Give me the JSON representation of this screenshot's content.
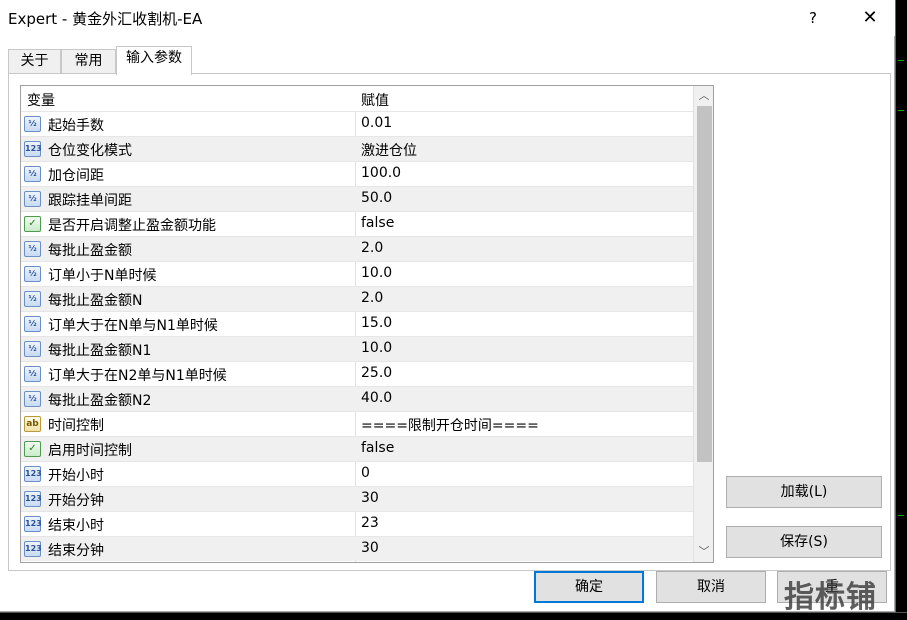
{
  "window": {
    "title": "Expert - 黄金外汇收割机-EA",
    "help_label": "?",
    "close_label": "✕"
  },
  "tabs": [
    {
      "label": "关于"
    },
    {
      "label": "常用"
    },
    {
      "label": "输入参数"
    }
  ],
  "active_tab": "输入参数",
  "grid": {
    "headers": {
      "variable": "变量",
      "value": "赋值"
    },
    "rows": [
      {
        "icon": "double-type-icon",
        "icon_glyph": "½",
        "name": "起始手数",
        "value": "0.01"
      },
      {
        "icon": "int-type-icon",
        "icon_glyph": "123",
        "name": "仓位变化模式",
        "value": "激进仓位"
      },
      {
        "icon": "double-type-icon",
        "icon_glyph": "½",
        "name": "加仓间距",
        "value": "100.0"
      },
      {
        "icon": "double-type-icon",
        "icon_glyph": "½",
        "name": "跟踪挂单间距",
        "value": "50.0"
      },
      {
        "icon": "bool-type-icon",
        "icon_glyph": "✓",
        "name": "是否开启调整止盈金额功能",
        "value": "false"
      },
      {
        "icon": "double-type-icon",
        "icon_glyph": "½",
        "name": "每批止盈金额",
        "value": "2.0"
      },
      {
        "icon": "double-type-icon",
        "icon_glyph": "½",
        "name": "订单小于N单时候",
        "value": "10.0"
      },
      {
        "icon": "double-type-icon",
        "icon_glyph": "½",
        "name": "每批止盈金额N",
        "value": "2.0"
      },
      {
        "icon": "double-type-icon",
        "icon_glyph": "½",
        "name": "订单大于在N单与N1单时候",
        "value": "15.0"
      },
      {
        "icon": "double-type-icon",
        "icon_glyph": "½",
        "name": "每批止盈金额N1",
        "value": "10.0"
      },
      {
        "icon": "double-type-icon",
        "icon_glyph": "½",
        "name": "订单大于在N2单与N1单时候",
        "value": "25.0"
      },
      {
        "icon": "double-type-icon",
        "icon_glyph": "½",
        "name": "每批止盈金额N2",
        "value": "40.0"
      },
      {
        "icon": "string-type-icon",
        "icon_glyph": "ab",
        "name": "时间控制",
        "value": "====限制开仓时间===="
      },
      {
        "icon": "bool-type-icon",
        "icon_glyph": "✓",
        "name": "启用时间控制",
        "value": "false"
      },
      {
        "icon": "int-type-icon",
        "icon_glyph": "123",
        "name": "开始小时",
        "value": "0"
      },
      {
        "icon": "int-type-icon",
        "icon_glyph": "123",
        "name": "开始分钟",
        "value": "30"
      },
      {
        "icon": "int-type-icon",
        "icon_glyph": "123",
        "name": "结束小时",
        "value": "23"
      },
      {
        "icon": "int-type-icon",
        "icon_glyph": "123",
        "name": "结束分钟",
        "value": "30"
      }
    ]
  },
  "scrollbar": {
    "up_glyph": "︿",
    "down_glyph": "﹀"
  },
  "buttons": {
    "load": "加载(L)",
    "save": "保存(S)",
    "ok": "确定",
    "cancel": "取消",
    "reset": "重"
  },
  "watermark": "指标铺",
  "colors": {
    "focus_border": "#0078d7",
    "alt_row": "#f0f0f0",
    "chart_bg": "#000000"
  }
}
